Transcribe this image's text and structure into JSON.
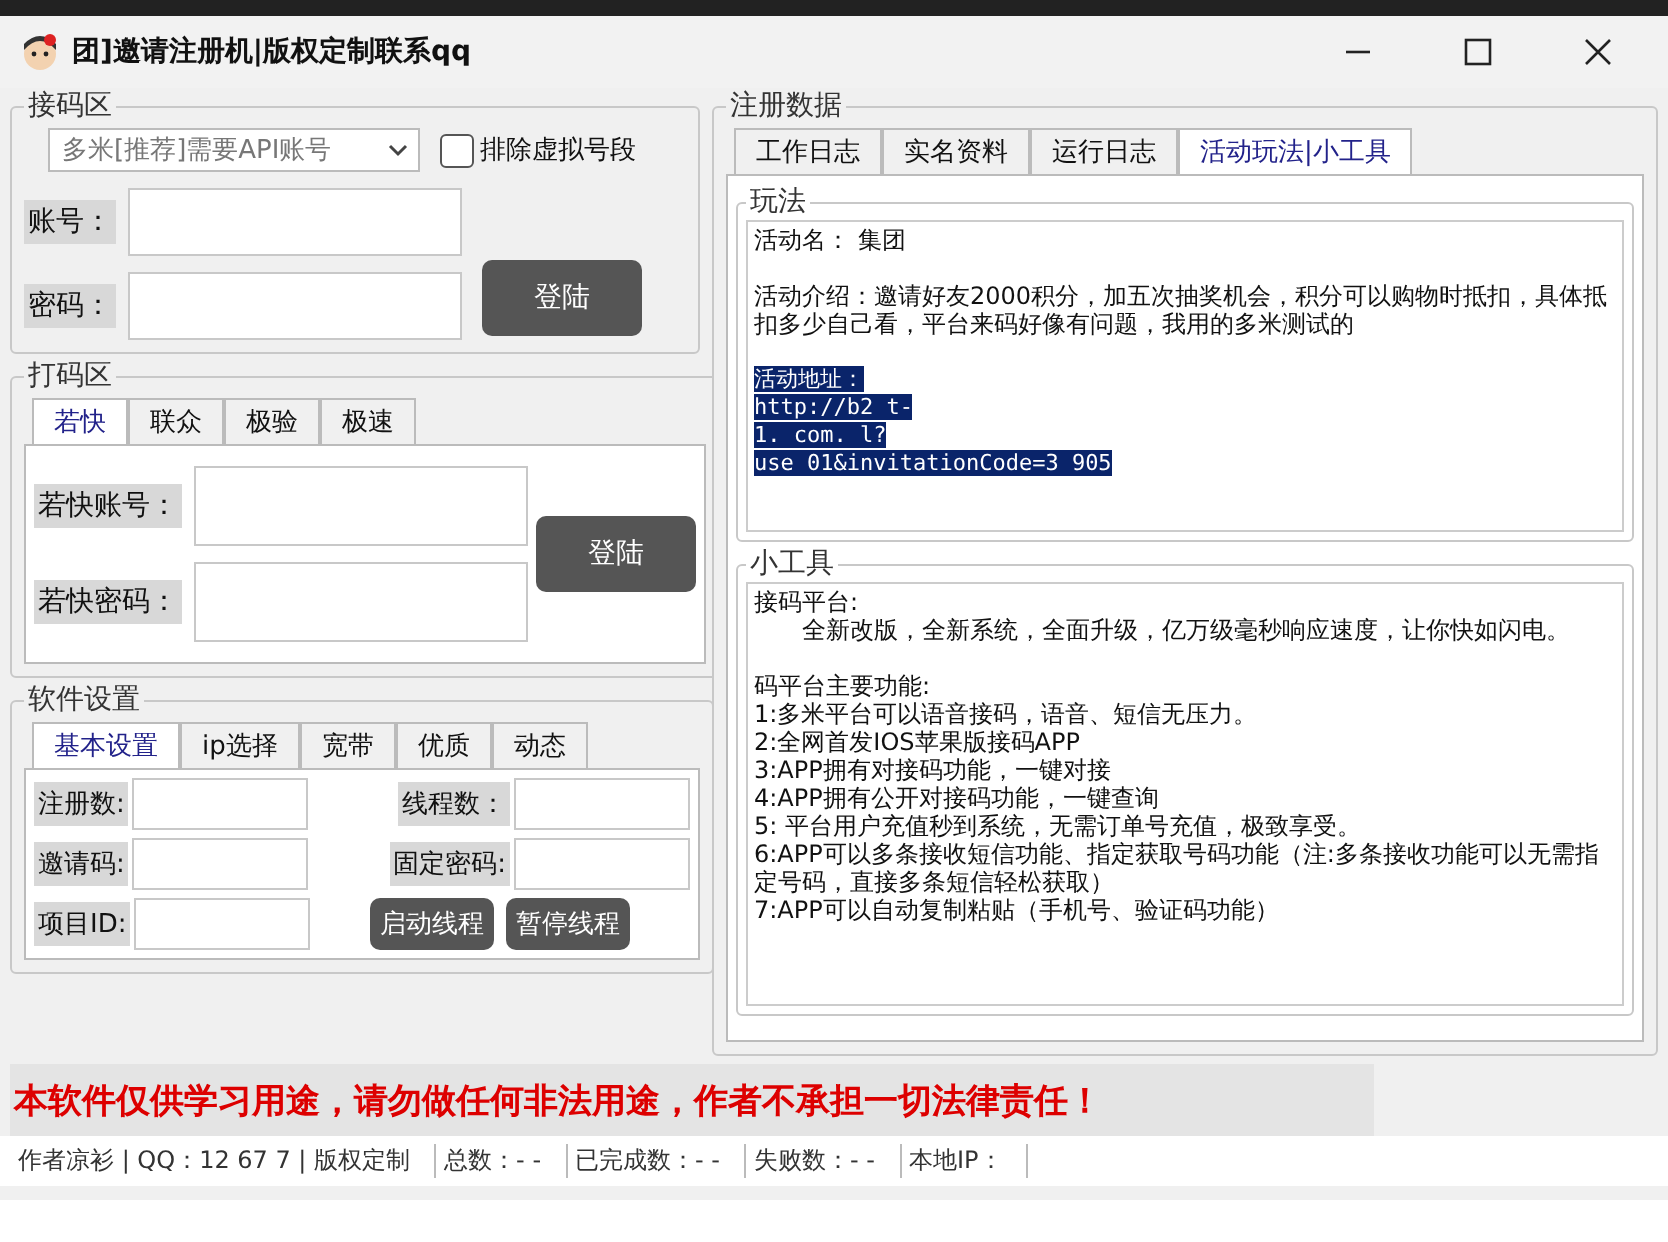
{
  "window": {
    "title": "团]邀请注册机|版权定制联系qq"
  },
  "receive": {
    "legend": "接码区",
    "platform_select": "多米[推荐]需要API账号",
    "exclude_checkbox": {
      "label": "排除虚拟号段",
      "checked": false
    },
    "fields": [
      {
        "label": "账号："
      },
      {
        "label": "密码："
      }
    ],
    "login_button": "登陆"
  },
  "captcha": {
    "legend": "打码区",
    "tabs": [
      {
        "label": "若快",
        "selected": true
      },
      {
        "label": "联众",
        "selected": false
      },
      {
        "label": "极验",
        "selected": false
      },
      {
        "label": "极速",
        "selected": false
      }
    ],
    "fields": [
      {
        "label": "若快账号："
      },
      {
        "label": "若快密码："
      }
    ],
    "login_button": "登陆"
  },
  "settings": {
    "legend": "软件设置",
    "tabs": [
      {
        "label": "基本设置",
        "selected": true
      },
      {
        "label": "ip选择",
        "selected": false
      },
      {
        "label": "宽带",
        "selected": false
      },
      {
        "label": "优质",
        "selected": false
      },
      {
        "label": "动态",
        "selected": false
      }
    ],
    "fields": [
      {
        "label": "注册数:"
      },
      {
        "label": "线程数："
      },
      {
        "label": "邀请码:"
      },
      {
        "label": "固定密码:"
      },
      {
        "label": "项目ID:"
      }
    ],
    "buttons": [
      "启动线程",
      "暂停线程"
    ]
  },
  "data_panel": {
    "legend": "注册数据",
    "tabs": [
      {
        "label": "工作日志",
        "selected": false
      },
      {
        "label": "实名资料",
        "selected": false
      },
      {
        "label": "运行日志",
        "selected": false
      },
      {
        "label": "活动玩法|小工具",
        "selected": true
      }
    ],
    "gameplay": {
      "legend": "玩法",
      "paragraphs": [
        {
          "text": "活动名： 集团",
          "selected": false
        },
        {
          "text": "活动介绍：邀请好友2000积分，加五次抽奖机会，积分可以购物时抵扣，具体抵扣多少自己看，平台来码好像有问题，我用的多米测试的",
          "selected": false
        },
        {
          "text": "活动地址：",
          "selected": true
        },
        {
          "text": "http://b2 t-",
          "selected": true
        },
        {
          "text": "1. com. l?",
          "selected": true
        },
        {
          "text": "use 01&invitationCode=3 905",
          "selected": true
        }
      ]
    },
    "tools": {
      "legend": "小工具",
      "paragraphs": [
        "接码平台:\n　　全新改版，全新系统，全面升级，亿万级毫秒响应速度，让你快如闪电。",
        "码平台主要功能:\n1:多米平台可以语音接码，语音、短信无压力。\n2:全网首发IOS苹果版接码APP\n3:APP拥有对接码功能，一键对接\n4:APP拥有公开对接码功能，一键查询\n5: 平台用户充值秒到系统，无需订单号充值，极致享受。\n6:APP可以多条接收短信功能、指定获取号码功能（注:多条接收功能可以无需指定号码，直接多条短信轻松获取）\n7:APP可以自动复制粘贴（手机号、验证码功能）"
      ]
    }
  },
  "disclaimer": "本软件仅供学习用途，请勿做任何非法用途，作者不承担一切法律责任！",
  "status_bar": [
    "作者凉衫 | QQ：12 67 7 | 版权定制",
    "总数：- -",
    "已完成数：- -",
    "失败数：- -",
    "本地IP："
  ]
}
